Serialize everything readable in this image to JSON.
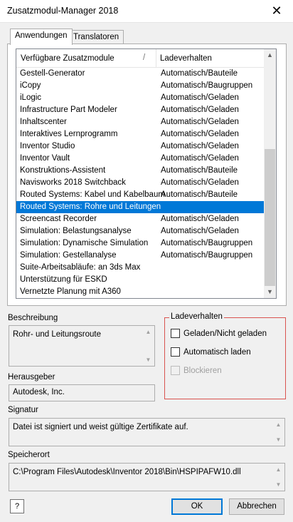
{
  "window": {
    "title": "Zusatzmodul-Manager 2018",
    "close_glyph": "✕"
  },
  "tabs": [
    {
      "label": "Anwendungen",
      "active": true
    },
    {
      "label": "Translatoren",
      "active": false
    }
  ],
  "list": {
    "col1_header": "Verfügbare Zusatzmodule",
    "sort_glyph": "/",
    "col2_header": "Ladeverhalten",
    "selected_index": 11,
    "rows": [
      {
        "name": "Gestell-Generator",
        "load": "Automatisch/Bauteile"
      },
      {
        "name": "iCopy",
        "load": "Automatisch/Baugruppen"
      },
      {
        "name": "iLogic",
        "load": "Automatisch/Geladen"
      },
      {
        "name": "Infrastructure Part Modeler",
        "load": "Automatisch/Geladen"
      },
      {
        "name": "Inhaltscenter",
        "load": "Automatisch/Geladen"
      },
      {
        "name": "Interaktives Lernprogramm",
        "load": "Automatisch/Geladen"
      },
      {
        "name": "Inventor Studio",
        "load": "Automatisch/Geladen"
      },
      {
        "name": "Inventor Vault",
        "load": "Automatisch/Geladen"
      },
      {
        "name": "Konstruktions-Assistent",
        "load": "Automatisch/Bauteile"
      },
      {
        "name": "Navisworks 2018 Switchback",
        "load": "Automatisch/Geladen"
      },
      {
        "name": "Routed Systems: Kabel und Kabelbaum",
        "load": "Automatisch/Bauteile"
      },
      {
        "name": "Routed Systems: Rohre und Leitungen",
        "load": ""
      },
      {
        "name": "Screencast Recorder",
        "load": "Automatisch/Geladen"
      },
      {
        "name": "Simulation: Belastungsanalyse",
        "load": "Automatisch/Geladen"
      },
      {
        "name": "Simulation: Dynamische Simulation",
        "load": "Automatisch/Baugruppen"
      },
      {
        "name": "Simulation: Gestellanalyse",
        "load": "Automatisch/Baugruppen"
      },
      {
        "name": "Suite-Arbeitsabläufe: an 3ds Max",
        "load": ""
      },
      {
        "name": "Unterstützung für ESKD",
        "load": ""
      },
      {
        "name": "Vernetzte Planung mit A360",
        "load": ""
      }
    ]
  },
  "description": {
    "label": "Beschreibung",
    "value": "Rohr- und Leitungsroute"
  },
  "publisher": {
    "label": "Herausgeber",
    "value": "Autodesk, Inc."
  },
  "signature": {
    "label": "Signatur",
    "value": "Datei ist signiert und weist gültige Zertifikate auf."
  },
  "location": {
    "label": "Speicherort",
    "value": "C:\\Program Files\\Autodesk\\Inventor 2018\\Bin\\HSPIPAFW10.dll"
  },
  "load_behavior": {
    "legend": "Ladeverhalten",
    "loaded": {
      "label": "Geladen/Nicht geladen",
      "checked": false
    },
    "auto": {
      "label": "Automatisch laden",
      "checked": false
    },
    "block": {
      "label": "Blockieren",
      "checked": false,
      "disabled": true
    }
  },
  "buttons": {
    "help": "?",
    "ok": "OK",
    "cancel": "Abbrechen"
  },
  "icons": {
    "up": "▲",
    "down": "▼"
  },
  "colors": {
    "selection": "#0078d7",
    "groupbox_border": "#d9534f"
  }
}
